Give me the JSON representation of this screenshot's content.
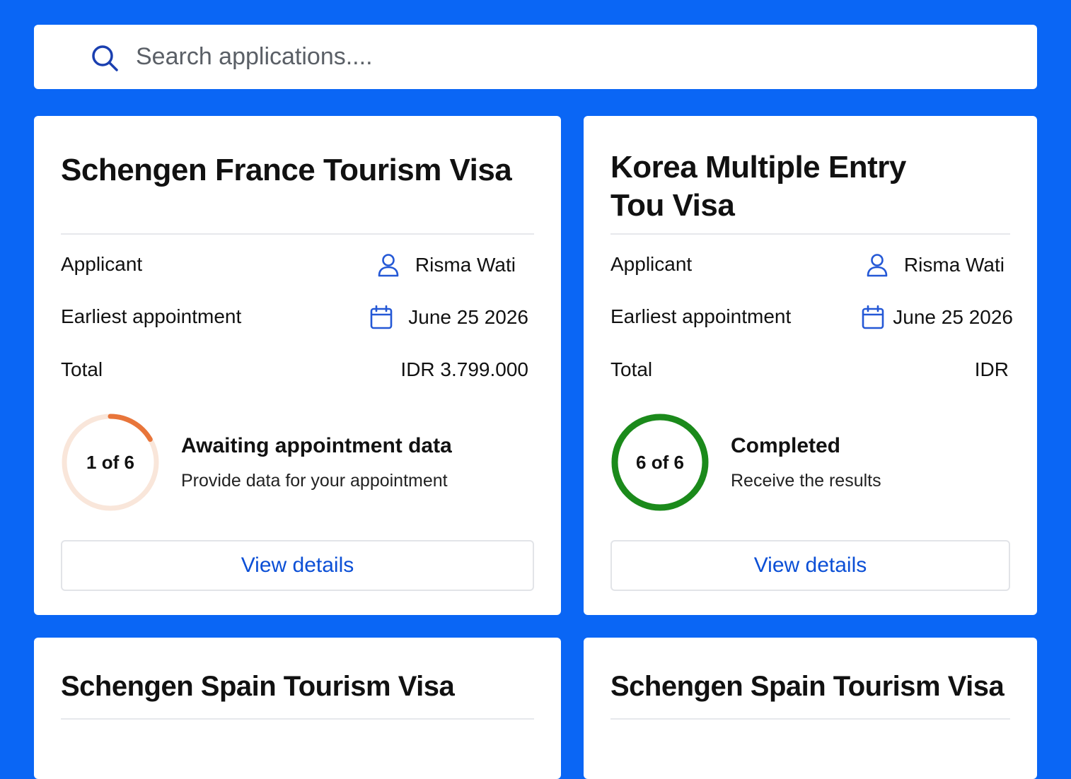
{
  "search": {
    "placeholder": "Search applications...."
  },
  "labels": {
    "applicant": "Applicant",
    "earliest_appointment": "Earliest appointment",
    "total": "Total",
    "view_details": "View details"
  },
  "colors": {
    "background": "#0a66f5",
    "link": "#0b4fd6",
    "progress_orange": "#e8753a",
    "progress_orange_track": "#f9e6da",
    "progress_green": "#1b8a1b"
  },
  "cards": [
    {
      "title": "Schengen France Tourism Visa",
      "applicant": "Risma Wati",
      "appointment": "June 25 2026",
      "total": "IDR 3.799.000",
      "progress_text": "1 of 6",
      "progress_step": 1,
      "progress_total": 6,
      "status_title": "Awaiting appointment data",
      "status_subtitle": "Provide data for your appointment"
    },
    {
      "title": "Korea Multiple Entry Tou Visa",
      "applicant": "Risma Wati",
      "appointment": "June 25 2026",
      "total": "IDR",
      "progress_text": "6 of 6",
      "progress_step": 6,
      "progress_total": 6,
      "status_title": "Completed",
      "status_subtitle": "Receive the results"
    },
    {
      "title": "Schengen Spain Tourism Visa"
    },
    {
      "title": "Schengen Spain Tourism Visa"
    }
  ]
}
